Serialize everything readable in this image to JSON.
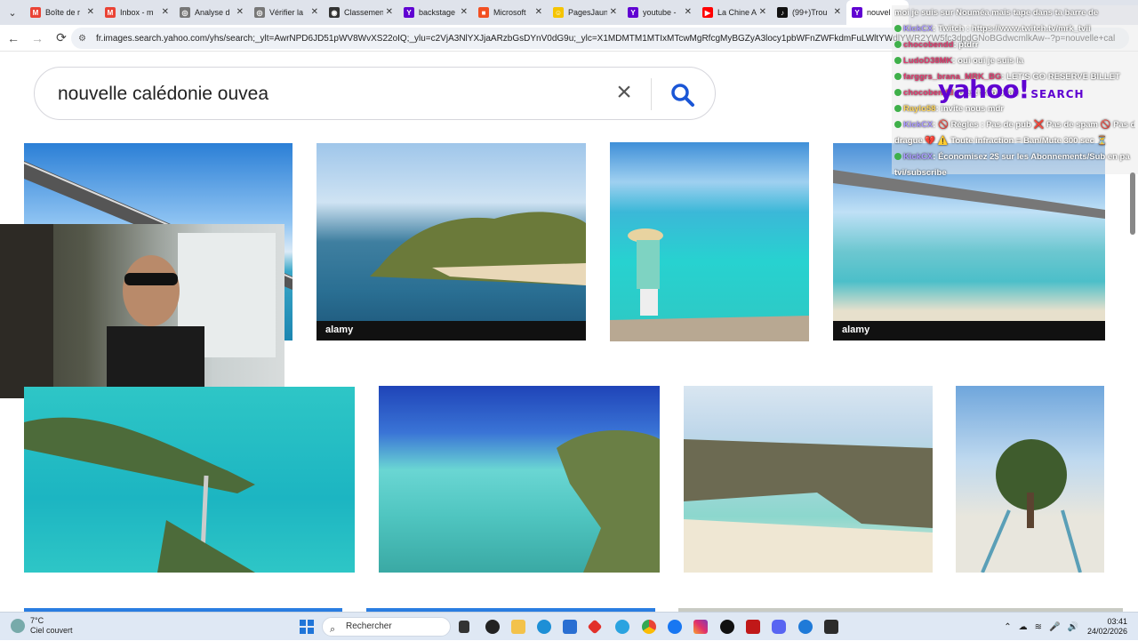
{
  "browser": {
    "tabs": [
      {
        "label": "Boîte de r",
        "color": "#ea4335",
        "glyph": "M"
      },
      {
        "label": "Inbox - m",
        "color": "#ea4335",
        "glyph": "M"
      },
      {
        "label": "Analyse d",
        "color": "#777777",
        "glyph": "◎"
      },
      {
        "label": "Vérifier la",
        "color": "#777777",
        "glyph": "◎"
      },
      {
        "label": "Classemen",
        "color": "#333333",
        "glyph": "◉"
      },
      {
        "label": "backstage",
        "color": "#6001d2",
        "glyph": "Y"
      },
      {
        "label": "Microsoft",
        "color": "#f25022",
        "glyph": "■"
      },
      {
        "label": "PagesJaun",
        "color": "#f5c400",
        "glyph": "☺"
      },
      {
        "label": "youtube -",
        "color": "#6001d2",
        "glyph": "Y"
      },
      {
        "label": "La Chine A",
        "color": "#ff0000",
        "glyph": "▶"
      },
      {
        "label": "(99+)Trou",
        "color": "#111111",
        "glyph": "♪"
      }
    ],
    "active_tab": {
      "label": "nouvel",
      "color": "#6001d2",
      "glyph": "Y"
    },
    "url": "fr.images.search.yahoo.com/yhs/search;_ylt=AwrNPD6JD51pWV8WvXS22oIQ;_ylu=c2VjA3NlYXJjaARzbGsDYnV0dG9u;_ylc=X1MDMTM1MTIxMTcwMgRfcgMyBGZyA3locy1pbWFnZWFkdmFuLWltYWdlYWR2YW5fc3dpdGNoBGdwcmlkAw--?p=nouvelle+cal"
  },
  "search": {
    "query": "nouvelle calédonie ouvea",
    "logo": "yahoo!",
    "logo_sub": "SEARCH"
  },
  "chat": [
    {
      "user": "",
      "text": "moi je suis sur Nouméa mais tape dans ta barre de"
    },
    {
      "user": "KickCX",
      "text": ": Twitch : https://www.twitch.tv/mrk_tvii"
    },
    {
      "user": "chocobendd",
      "text": ": ptdrr"
    },
    {
      "user": "LudoD38MK",
      "text": ": oui oui je suis la"
    },
    {
      "user": "farggrs_brana_MRK_BG",
      "text": ": LET'S GO RESERVE BILLET"
    },
    {
      "user": "chocobendd",
      "text": ": c'est trop beau"
    },
    {
      "user": "Raylo58",
      "text": ": invite nous mdr"
    },
    {
      "user": "KickCX",
      "text": ": 🚫 Règles : Pas de pub ❌ Pas de spam 🚫 Pas de"
    },
    {
      "user": "",
      "text": "drague 💔 ⚠️ Toute infraction = Ban/Mute 300 sec ⏳"
    },
    {
      "user": "KickCX",
      "text": ": Économisez 2$ sur les Abonnements/Sub en pa"
    },
    {
      "user": "",
      "text": "tvi/subscribe"
    }
  ],
  "images_row1_watermarks": [
    "alamy",
    "alamy",
    "",
    "alamy"
  ],
  "taskbar": {
    "temp": "7°C",
    "weather": "Ciel couvert",
    "search_placeholder": "Rechercher",
    "time": "03:41",
    "date": "24/02/2026"
  }
}
